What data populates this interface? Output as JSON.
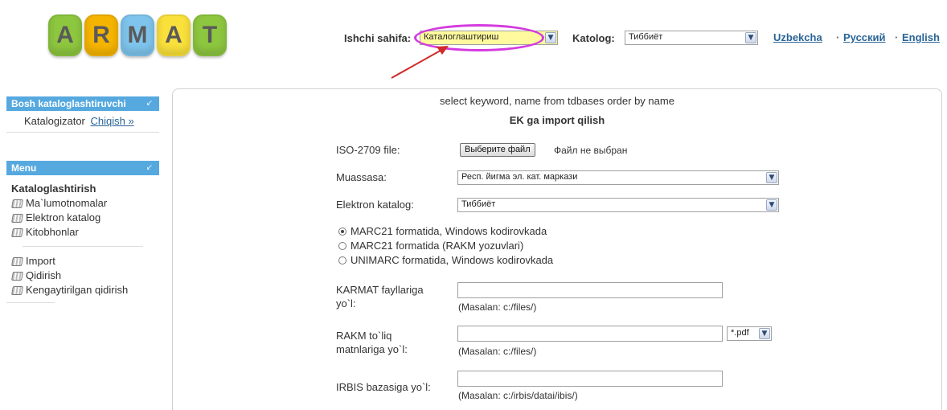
{
  "logo": {
    "letters": [
      {
        "char": "A",
        "color": "#8dc63f"
      },
      {
        "char": "R",
        "color": "#f5b400"
      },
      {
        "char": "M",
        "color": "#7ec4ec"
      },
      {
        "char": "A",
        "color": "#f9e03b"
      },
      {
        "char": "T",
        "color": "#8dc63f"
      }
    ]
  },
  "header": {
    "workpage_label": "Ishchi sahifa:",
    "workpage_value": "Каталоглаштириш",
    "catalog_label": "Katolog:",
    "catalog_value": "Тиббиёт",
    "languages": [
      "Uzbekcha",
      "Русский",
      "English"
    ],
    "separator": "·"
  },
  "sidebar": {
    "box1": {
      "title": "Bosh kataloglashtiruvchi",
      "user_role": "Katalogizator",
      "logout_link": "Chiqish »"
    },
    "box2": {
      "title": "Menu",
      "section_heading": "Kataloglashtirish",
      "items": [
        "Ma`lumotnomalar",
        "Elektron katalog",
        "Kitobhonlar"
      ],
      "items2": [
        "Import",
        "Qidirish",
        "Kengaytirilgan qidirish"
      ]
    }
  },
  "main": {
    "sql_text": "select keyword, name from tdbases order by name",
    "heading": "EK ga import qilish",
    "iso_label": "ISO-2709 file:",
    "file_button": "Выберите файл",
    "file_status": "Файл не выбран",
    "institution_label": "Muassasa:",
    "institution_value": "Респ. йигма эл. кат. маркази",
    "ecatalog_label": "Elektron katalog:",
    "ecatalog_value": "Тиббиёт",
    "formats": [
      {
        "label": "MARC21 formatida, Windows kodirovkada",
        "selected": true
      },
      {
        "label": "MARC21 formatida (RAKM yozuvlari)",
        "selected": false
      },
      {
        "label": "UNIMARC formatida, Windows kodirovkada",
        "selected": false
      }
    ],
    "karmat_label": "KARMAT fayllariga yo`l:",
    "karmat_hint": "(Masalan: c:/files/)",
    "rakm_label": "RAKM to`liq matnlariga yo`l:",
    "rakm_hint": "(Masalan: c:/files/)",
    "rakm_ext": "*.pdf",
    "irbis_label": "IRBIS bazasiga yo`l:",
    "irbis_hint": "(Masalan: c:/irbis/datai/ibis/)"
  },
  "colors": {
    "accent": "#55a9df",
    "highlight": "#d43adf",
    "arrow": "#d12a2a",
    "selected_bg": "#fffa9e"
  }
}
